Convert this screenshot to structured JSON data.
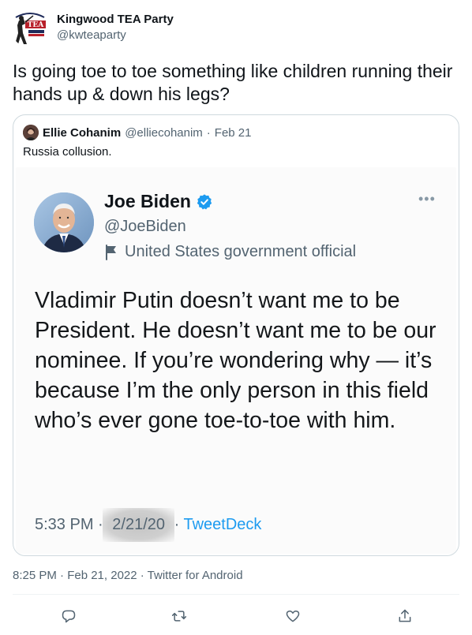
{
  "tweet": {
    "author": {
      "display_name": "Kingwood TEA Party",
      "handle": "@kwteaparty",
      "avatar_icon": "tea-party-logo-icon",
      "avatar_logo_text": "TEA"
    },
    "text": "Is going toe to toe something like children running their hands up & down his legs?",
    "timestamp": "8:25 PM · Feb 21, 2022 · Twitter for Android"
  },
  "quoted": {
    "author": {
      "display_name": "Ellie Cohanim",
      "handle": "@elliecohanim",
      "date": "Feb 21",
      "separator": "·"
    },
    "text": "Russia collusion."
  },
  "embedded_tweet": {
    "author": {
      "display_name": "Joe Biden",
      "handle": "@JoeBiden",
      "label": "United States government official"
    },
    "more_icon": "•••",
    "text": "Vladimir Putin doesn’t want me to be President. He doesn’t want me to be our nominee. If you’re wondering why — it’s because I’m the only person in this field who’s ever gone toe-to-toe with him.",
    "time": "5:33 PM",
    "date": "2/21/20",
    "source": "TweetDeck",
    "separator": "·"
  },
  "actions": [
    {
      "name": "reply",
      "icon": "reply-icon"
    },
    {
      "name": "retweet",
      "icon": "retweet-icon"
    },
    {
      "name": "like",
      "icon": "like-icon"
    },
    {
      "name": "share",
      "icon": "share-icon"
    }
  ],
  "colors": {
    "accent": "#1d9bf0",
    "text": "#0f1419",
    "secondary": "#536471",
    "border": "#cfd9de"
  }
}
